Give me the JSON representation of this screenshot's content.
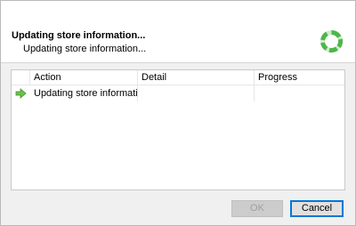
{
  "dialog": {
    "title": "Updating store information...",
    "subtitle": "Updating store information..."
  },
  "spinner": {
    "icon": "loading-spinner-icon",
    "color": "#4cb848"
  },
  "list": {
    "columns": [
      {
        "label": "Action"
      },
      {
        "label": "Detail"
      },
      {
        "label": "Progress"
      }
    ],
    "rows": [
      {
        "icon": "green-arrow-right-icon",
        "action": "Updating store information...",
        "detail": "",
        "progress": ""
      }
    ]
  },
  "buttons": {
    "ok_label": "OK",
    "cancel_label": "Cancel"
  }
}
